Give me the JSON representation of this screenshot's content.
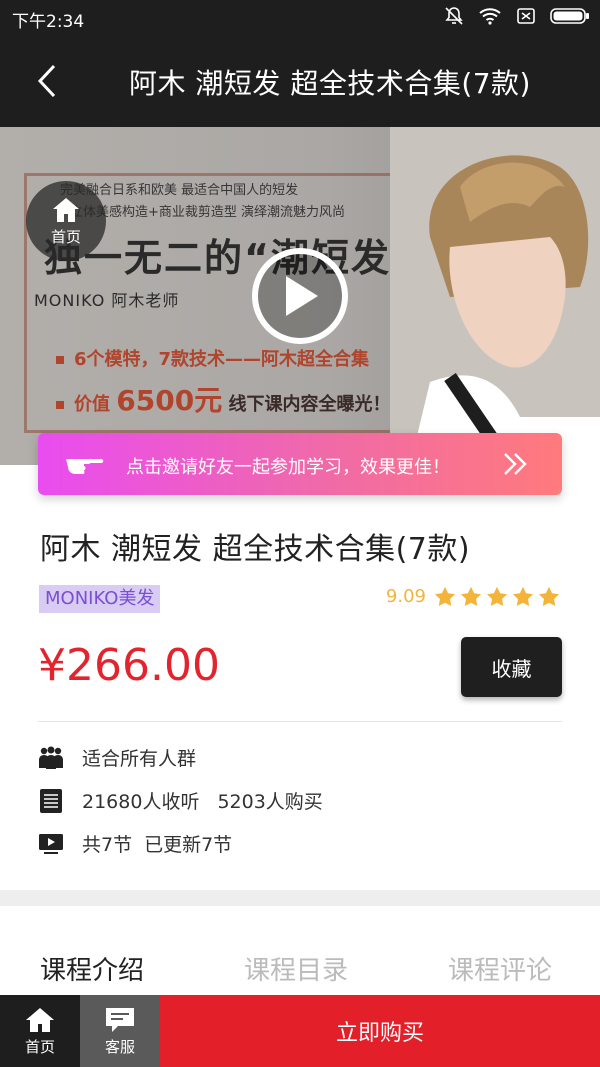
{
  "status_bar": {
    "time": "下午2:34"
  },
  "nav": {
    "title": "阿木 潮短发 超全技术合集(7款)"
  },
  "banner": {
    "line1": "完美融合日系和欧美  最适合中国人的短发",
    "line2": "立体美感构造+商业裁剪造型  演绎潮流魅力风尚",
    "headline": "独一无二的“潮短发”",
    "teacher": "MONIKO   阿木老师",
    "bullet1": "6个模特，7款技术——阿木超全合集",
    "bullet2_prefix": "价值 ",
    "bullet2_value": "6500元",
    "bullet2_suffix": " 线下课内容全曝光！",
    "home_label": "首页"
  },
  "invite": {
    "text": "点击邀请好友一起参加学习，效果更佳！"
  },
  "course": {
    "title": "阿木 潮短发 超全技术合集(7款)",
    "org": "MONIKO美发",
    "rating": "9.09",
    "stars": 5,
    "price": "¥266.00",
    "favorite_label": "收藏",
    "audience": "适合所有人群",
    "listeners": "21680人收听",
    "buyers": "5203人购买",
    "lessons_total": "共7节",
    "lessons_updated": "已更新7节"
  },
  "tabs": [
    {
      "label": "课程介绍"
    },
    {
      "label": "课程目录"
    },
    {
      "label": "课程评论"
    }
  ],
  "bottom_bar": {
    "home_label": "首页",
    "service_label": "客服",
    "buy_label": "立即购买"
  },
  "colors": {
    "accent_red": "#e31f29",
    "star": "#f4b43a",
    "org_tag_bg": "#d9ccf4",
    "org_tag_text": "#7a4fd1"
  }
}
